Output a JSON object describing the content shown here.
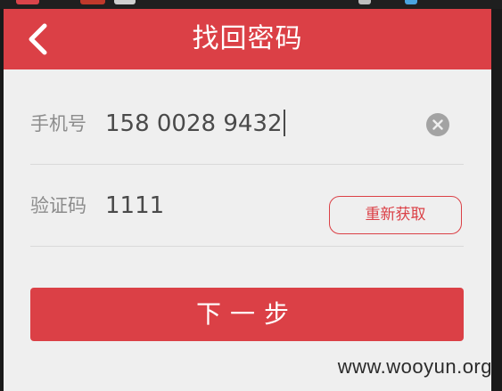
{
  "header": {
    "title": "找回密码",
    "back_icon": "chevron-left-icon"
  },
  "form": {
    "phone_label": "手机号",
    "phone_value": "158 0028 9432",
    "clear_icon": "clear-circle-icon",
    "code_label": "验证码",
    "code_value": "1111",
    "resend_label": "重新获取"
  },
  "actions": {
    "next_label": "下一步"
  },
  "watermark": "www.wooyun.org",
  "colors": {
    "accent": "#db4046",
    "background": "#efefef",
    "label_text": "#8c8c8c",
    "value_text": "#4a4a4a"
  }
}
